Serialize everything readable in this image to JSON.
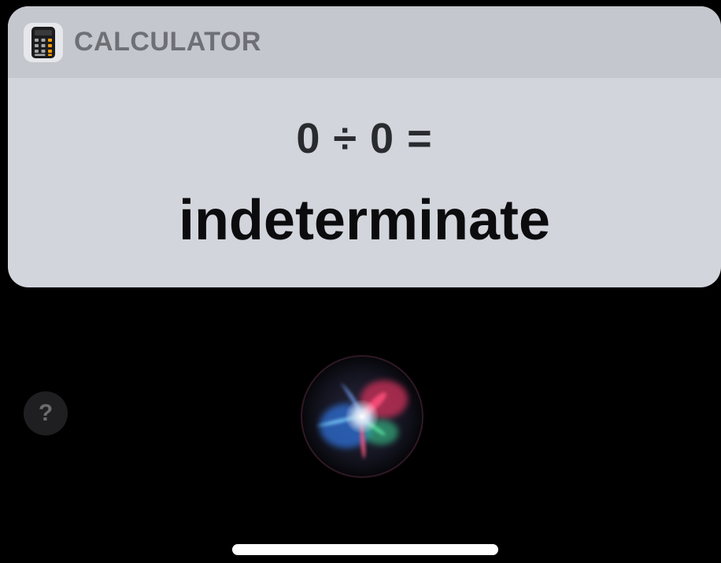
{
  "app": {
    "title": "CALCULATOR",
    "icon": "calculator-icon"
  },
  "calculation": {
    "expression": "0 ÷ 0 =",
    "result": "indeterminate"
  },
  "help": {
    "label": "?"
  },
  "siri": {
    "icon": "siri-orb-icon"
  },
  "colors": {
    "background": "#000000",
    "card_body": "#d2d5db",
    "card_header": "#c4c7cd",
    "header_text": "#6e7076",
    "expression_text": "#2a2b2f",
    "result_text": "#0c0c0e",
    "home_indicator": "#ffffff"
  }
}
